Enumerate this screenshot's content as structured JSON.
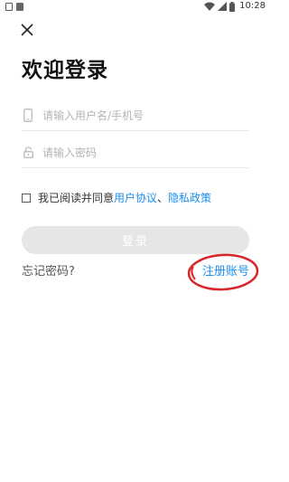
{
  "status_bar": {
    "time": "10:28",
    "left_icons": [
      "sim-icon",
      "notification-icon"
    ],
    "right_icons": [
      "wifi-icon",
      "signal-icon",
      "battery-icon"
    ]
  },
  "header": {
    "close_icon": "close-icon"
  },
  "page": {
    "title": "欢迎登录"
  },
  "form": {
    "username": {
      "icon": "phone-icon",
      "placeholder": "请输入用户名/手机号",
      "value": ""
    },
    "password": {
      "icon": "lock-icon",
      "placeholder": "请输入密码",
      "value": ""
    },
    "agreement": {
      "checked": false,
      "prefix": "我已阅读并同意",
      "user_agreement": "用户协议",
      "separator": "、",
      "privacy_policy": "隐私政策"
    },
    "login_label": "登录"
  },
  "footer": {
    "forgot_password": "忘记密码?",
    "register": "注册账号"
  },
  "colors": {
    "link": "#1a8ef0",
    "button_disabled": "#e6e6e6",
    "annotation": "#d9262c"
  }
}
